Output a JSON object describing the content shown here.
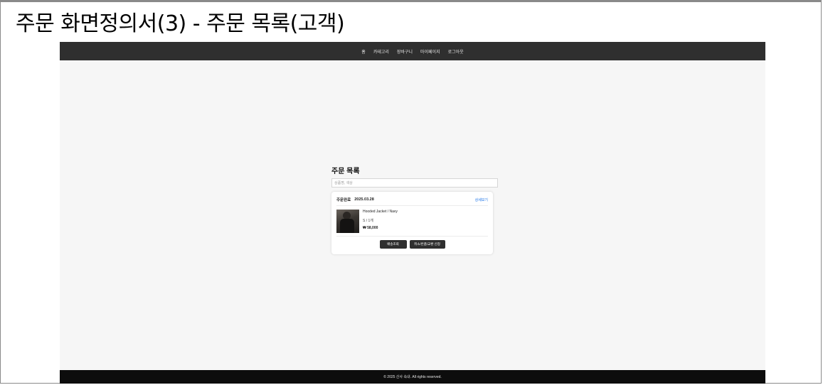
{
  "doc_title": "주문 화면정의서(3) - 주문 목록(고객)",
  "nav": {
    "items": [
      "홈",
      "카테고리",
      "장바구니",
      "마이페이지",
      "로그아웃"
    ]
  },
  "main": {
    "heading": "주문 목록",
    "search": {
      "placeholder": "상품명, 색상",
      "value": ""
    }
  },
  "order": {
    "status": "주문완료",
    "date": "2025.03.28",
    "detail_link": "상세보기",
    "product_name": "Hooded Jacket / Navy",
    "option": "S / 1개",
    "price": "₩ 58,000",
    "buttons": {
      "track": "배송조회",
      "cancel": "취소/반품/교환 신청"
    }
  },
  "footer": {
    "text": "© 2025 신사 속내. All rights reserved."
  },
  "colors": {
    "nav_bg": "#2f2f2f",
    "footer_bg": "#0d0d0d",
    "link": "#1a73e8",
    "page_bg": "#f6f6f6"
  }
}
